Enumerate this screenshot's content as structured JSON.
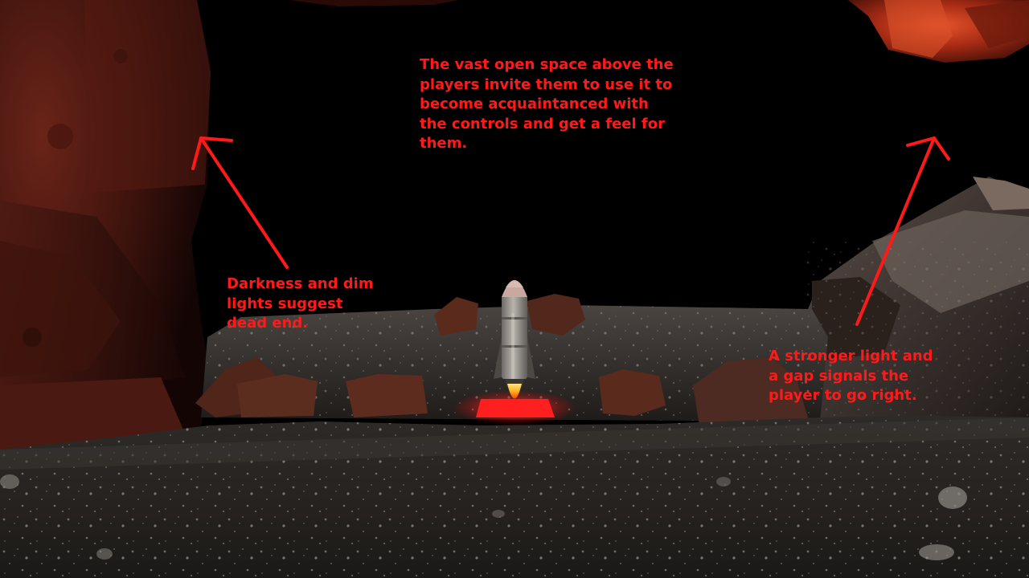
{
  "annotations": {
    "top": "The vast open space above the\nplayers invite them to use it to\nbecome acquaintanced with\nthe controls and get a feel for\nthem.",
    "left": "Darkness and dim\nlights suggest\ndead end.",
    "right": "A stronger light and\na gap signals the\nplayer to go right."
  },
  "colors": {
    "annotation": "#ff1a1a",
    "background": "#000000",
    "cave_wall_red": "#5a1d14",
    "lit_rock": "#c0341c",
    "ground": "#2a2623",
    "landing_pad": "#ff1f1f",
    "rocket_flame": "#ffcc33"
  }
}
